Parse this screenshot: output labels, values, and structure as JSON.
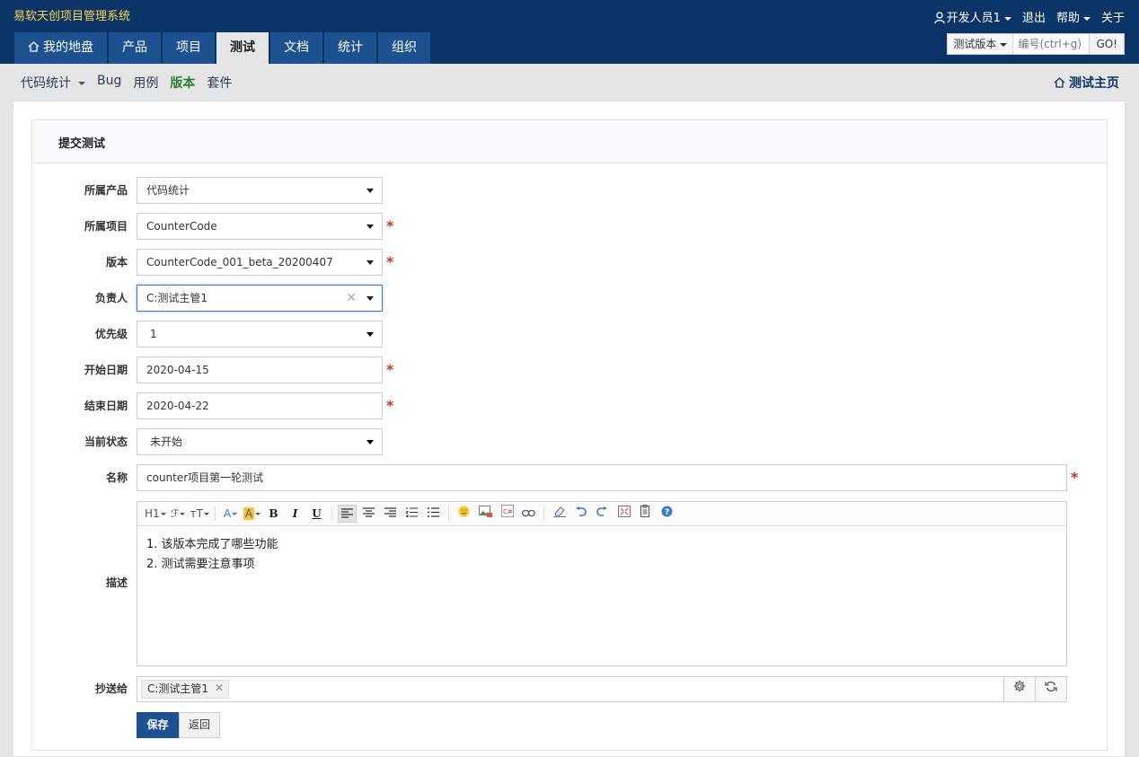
{
  "header": {
    "brand": "易软天创项目管理系统",
    "user": "开发人员1",
    "logout": "退出",
    "help": "帮助",
    "about": "关于"
  },
  "nav": {
    "tabs": [
      {
        "label": "我的地盘"
      },
      {
        "label": "产品"
      },
      {
        "label": "项目"
      },
      {
        "label": "测试",
        "active": true
      },
      {
        "label": "文档"
      },
      {
        "label": "统计"
      },
      {
        "label": "组织"
      }
    ]
  },
  "search": {
    "type": "测试版本",
    "placeholder": "编号(ctrl+g)",
    "go": "GO!"
  },
  "subnav": {
    "product": "代码统计",
    "items": [
      "Bug",
      "用例",
      "版本",
      "套件"
    ],
    "home": "测试主页"
  },
  "form": {
    "title": "提交测试",
    "product_label": "所属产品",
    "product_value": "代码统计",
    "project_label": "所属项目",
    "project_value": "CounterCode",
    "build_label": "版本",
    "build_value": "CounterCode_001_beta_20200407",
    "owner_label": "负责人",
    "owner_value": "C:测试主管1",
    "priority_label": "优先级",
    "priority_value": "1",
    "begin_label": "开始日期",
    "begin_value": "2020-04-15",
    "end_label": "结束日期",
    "end_value": "2020-04-22",
    "status_label": "当前状态",
    "status_value": "未开始",
    "name_label": "名称",
    "name_value": "counter项目第一轮测试",
    "desc_label": "描述",
    "desc_line1": "1. 该版本完成了哪些功能",
    "desc_line2": "2. 测试需要注意事项",
    "cc_label": "抄送给",
    "cc_chip": "C:测试主管1",
    "required_mark": "*",
    "save": "保存",
    "back": "返回"
  },
  "toolbar": {
    "h1": "H1",
    "font": "ℱ",
    "size": "ᴛT",
    "color": "A",
    "bg": "A",
    "bold": "B",
    "italic": "I",
    "underline": "U"
  },
  "colors": {
    "header_bg": "#0b3566",
    "tab_bg": "#1d5190",
    "brand": "#ffd24f",
    "required": "#c0392b",
    "active_sub": "#2e7d32"
  }
}
